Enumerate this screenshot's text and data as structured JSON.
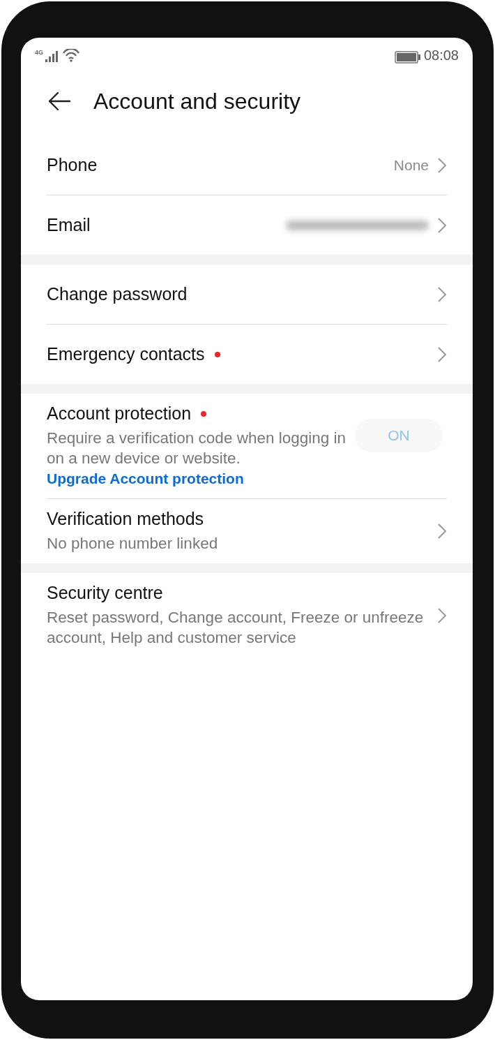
{
  "status_bar": {
    "network": "4G",
    "time": "08:08"
  },
  "header": {
    "title": "Account and security"
  },
  "sections": [
    {
      "items": [
        {
          "kind": "link",
          "label": "Phone",
          "value": "None",
          "badge": false
        },
        {
          "kind": "link",
          "label": "Email",
          "value_hidden": true,
          "badge": false
        }
      ]
    },
    {
      "items": [
        {
          "kind": "link",
          "label": "Change password",
          "badge": false
        },
        {
          "kind": "link",
          "label": "Emergency contacts",
          "badge": true
        }
      ]
    },
    {
      "items": [
        {
          "kind": "toggle",
          "label": "Account protection",
          "badge": true,
          "subtitle": "Require a verification code when logging in on a new device or website.",
          "link": "Upgrade Account protection",
          "toggle": {
            "label": "ON",
            "disabled": true
          }
        },
        {
          "kind": "link",
          "label": "Verification methods",
          "subtitle": "No phone number linked",
          "badge": false
        }
      ]
    },
    {
      "items": [
        {
          "kind": "link",
          "label": "Security centre",
          "subtitle": "Reset password, Change account, Freeze or unfreeze account, Help and customer service",
          "badge": false
        }
      ]
    }
  ]
}
